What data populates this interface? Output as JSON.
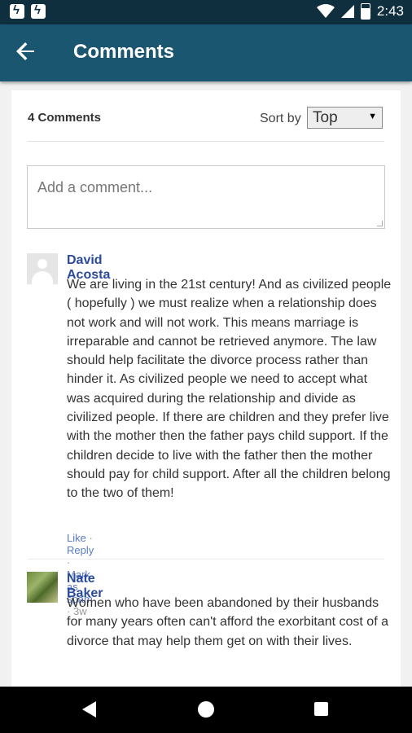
{
  "status_bar": {
    "time": "2:43",
    "icons": [
      "notification-icon",
      "notification-icon",
      "wifi-icon",
      "signal-icon",
      "battery-icon"
    ]
  },
  "app_bar": {
    "back_icon": "arrow-left-icon",
    "title": "Comments"
  },
  "comments_header": {
    "count_label": "4 Comments",
    "sort_label": "Sort by",
    "sort_value": "Top"
  },
  "composer": {
    "placeholder": "Add a comment..."
  },
  "comments": [
    {
      "author": "David Acosta",
      "avatar": "default-avatar",
      "text": "We are living in the 21st century! And as civilized people ( hopefully ) we must realize when a relationship does not work and will not work. This means marriage is irreparable and cannot be retrieved anymore. The law should help facilitate the divorce process rather than hinder it. As civilized people we need to accept what was acquired during the relationship and divide as civilized people. If there are children and they prefer live with the mother then the father pays child support. If the children decide to live with the father then the mother should pay for child support. After all the children belong to the two of them!",
      "like": "Like",
      "reply": "Reply",
      "spam": "Mark as spam",
      "separator": "·",
      "time": "3w"
    },
    {
      "author": "Nate Baker",
      "avatar": "photo-avatar",
      "text": "Women who have been abandoned by their husbands for many years often can't afford the exorbitant cost of a divorce that may help them get on with their lives."
    }
  ],
  "nav_bar": {
    "icons": [
      "back-triangle-icon",
      "home-circle-icon",
      "recents-square-icon"
    ]
  },
  "colors": {
    "status_bar": "#0f2f3f",
    "app_bar": "#1b5670",
    "author_link": "#2a4a9c",
    "action_link": "#5b7bc8"
  }
}
